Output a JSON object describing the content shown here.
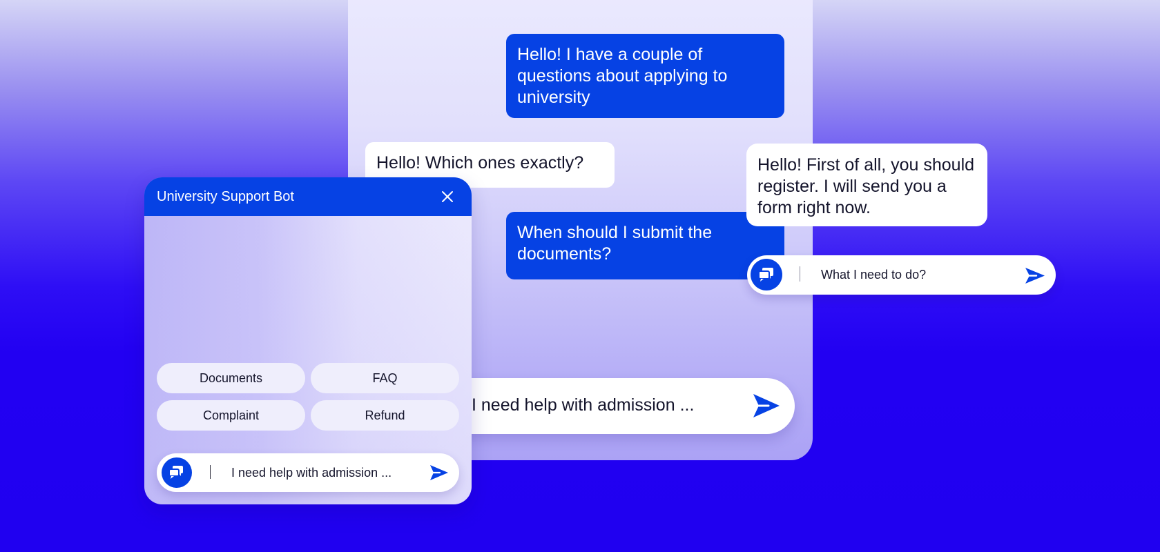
{
  "colors": {
    "accent": "#0642e4",
    "bubble_bot": "#ffffff",
    "text_dark": "#14142b"
  },
  "main_chat": {
    "messages": [
      {
        "role": "user",
        "text": "Hello! I have a couple of questions about applying to university"
      },
      {
        "role": "bot",
        "text": "Hello! Which ones exactly?"
      },
      {
        "role": "user",
        "text": "When should I submit the documents?"
      }
    ],
    "input_value": "I need help with admission ...",
    "send_icon": "send-icon"
  },
  "floating": {
    "bot_message": "Hello! First of all, you should register. I will send you a form right now.",
    "input_value": "What I need to do?",
    "avatar_icon": "chat-icon",
    "send_icon": "send-icon"
  },
  "widget": {
    "title": "University Support Bot",
    "close_icon": "close-icon",
    "quick_replies": [
      "Documents",
      "FAQ",
      "Complaint",
      "Refund"
    ],
    "input_value": "I need help with admission ...",
    "avatar_icon": "chat-icon",
    "send_icon": "send-icon"
  }
}
